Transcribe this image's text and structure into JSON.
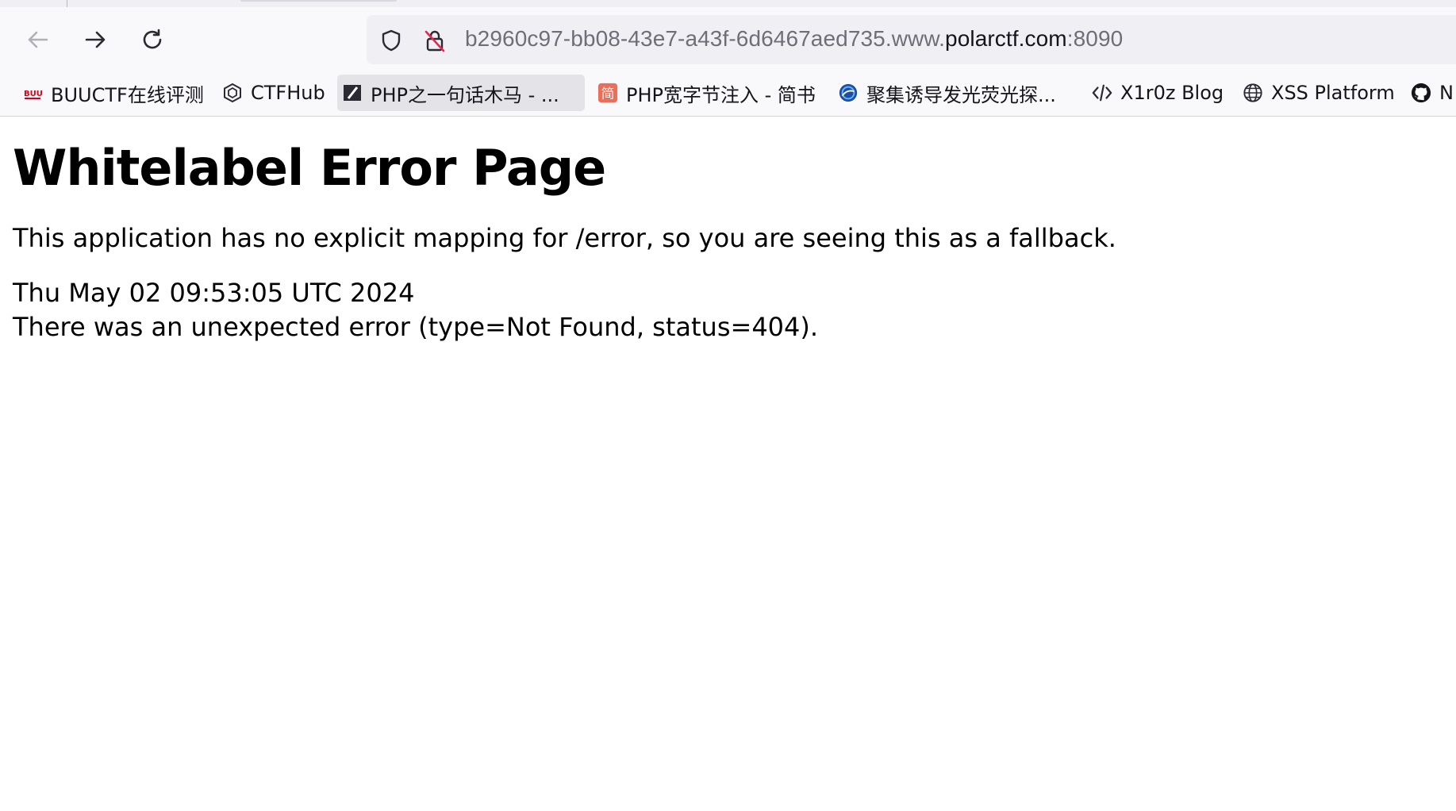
{
  "browser": {
    "nav": {
      "back_icon": "arrow-left-icon",
      "forward_icon": "arrow-right-icon",
      "reload_icon": "reload-icon"
    },
    "urlbar": {
      "shield_icon": "shield-icon",
      "lock_icon": "insecure-lock-icon",
      "url_prefix": "b2960c97-bb08-43e7-a43f-6d6467aed735.www.",
      "url_domain": "polarctf.com",
      "url_suffix": ":8090"
    },
    "bookmarks": [
      {
        "label": "BUUCTF在线评测",
        "icon": "buuctf-icon"
      },
      {
        "label": "CTFHub",
        "icon": "ctfhub-icon"
      },
      {
        "label": "PHP之一句话木马 - ...",
        "icon": "zhihu-slash-icon"
      },
      {
        "label": "PHP宽字节注入 - 简书",
        "icon": "jianshu-icon"
      },
      {
        "label": "聚集诱导发光荧光探...",
        "icon": "globe-blue-icon"
      },
      {
        "label": "X1r0z Blog",
        "icon": "code-icon"
      },
      {
        "label": "XSS Platform",
        "icon": "globe-icon"
      },
      {
        "label": "N",
        "icon": "github-icon"
      }
    ],
    "colors": {
      "toolbar_bg": "#f9f9fb",
      "urlbar_bg": "#f0f0f4",
      "jianshu_red": "#ea6f5a",
      "buuctf_red": "#d0021b"
    }
  },
  "page": {
    "title": "Whitelabel Error Page",
    "message": "This application has no explicit mapping for /error, so you are seeing this as a fallback.",
    "timestamp": "Thu May 02 09:53:05 UTC 2024",
    "error": "There was an unexpected error (type=Not Found, status=404)."
  }
}
